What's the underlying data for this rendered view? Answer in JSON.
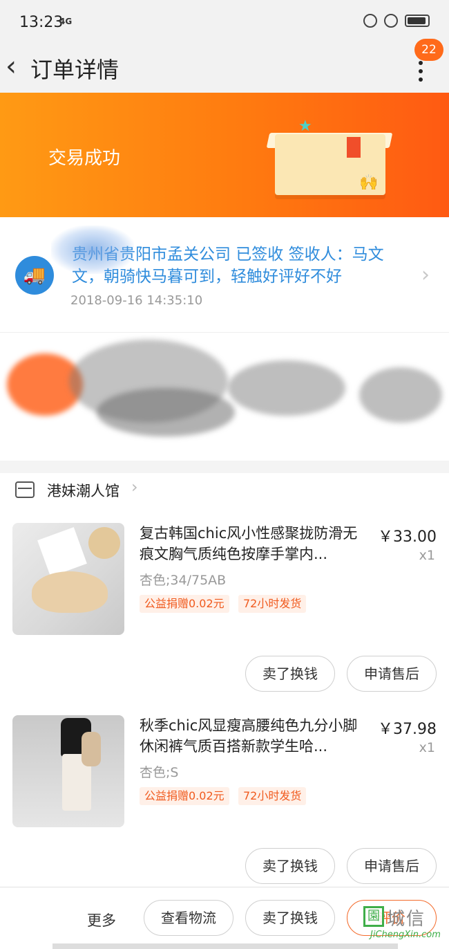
{
  "status_bar": {
    "time": "13:23",
    "signal": "4G"
  },
  "nav": {
    "title": "订单详情",
    "badge_count": "22"
  },
  "banner": {
    "title": "交易成功"
  },
  "logistics": {
    "text": "贵州省贵阳市孟关公司 已签收 签收人：马文文，朝骑快马暮可到，轻触好评好不好",
    "time": "2018-09-16 14:35:10"
  },
  "shop": {
    "name": "港妹潮人馆"
  },
  "items": [
    {
      "title": "复古韩国chic风小性感聚拢防滑无痕文胸气质纯色按摩手掌内...",
      "sku": "杏色;34/75AB",
      "tags": [
        "公益捐赠0.02元",
        "72小时发货"
      ],
      "price": "￥33.00",
      "qty": "x1",
      "buttons": [
        "卖了换钱",
        "申请售后"
      ]
    },
    {
      "title": "秋季chic风显瘦高腰纯色九分小脚休闲裤气质百搭新款学生哈...",
      "sku": "杏色;S",
      "tags": [
        "公益捐赠0.02元",
        "72小时发货"
      ],
      "price": "￥37.98",
      "qty": "x1",
      "buttons": [
        "卖了换钱",
        "申请售后"
      ]
    }
  ],
  "bottom_bar": {
    "more": "更多",
    "buttons": [
      "查看物流",
      "卖了换钱",
      "评价"
    ]
  },
  "watermark": {
    "text": "城信",
    "url": "JiChengXin.com",
    "mark": "園"
  },
  "colors": {
    "accent": "#ff6a1a",
    "link_blue": "#2f8cdc",
    "tag_orange": "#f05a1e"
  }
}
